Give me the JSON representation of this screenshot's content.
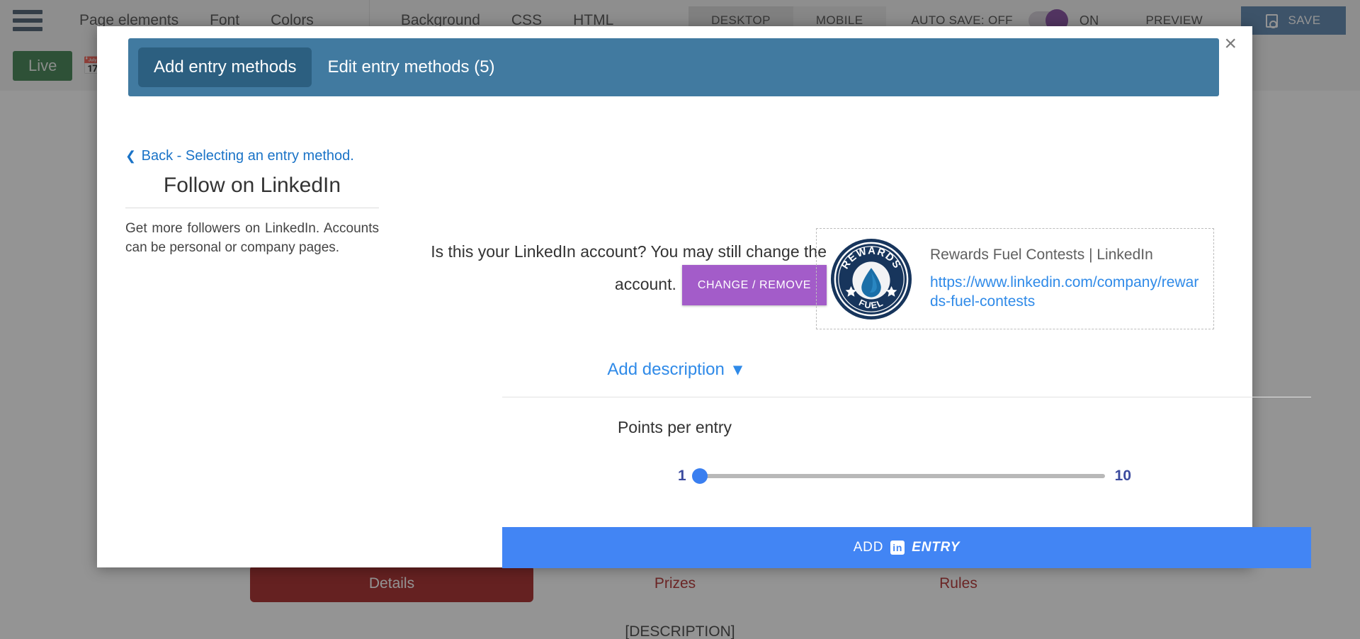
{
  "toolbar": {
    "menu_icon": "hamburger-icon",
    "items": [
      "Page elements",
      "Font",
      "Colors",
      "Background",
      "CSS",
      "HTML"
    ],
    "desktop_label": "DESKTOP",
    "mobile_label": "MOBILE",
    "autosave_label": "AUTO SAVE: OFF",
    "toggle_on_label": "ON",
    "preview_label": "PREVIEW",
    "save_label": "SAVE"
  },
  "secondbar": {
    "live_label": "Live",
    "calendar_icon": "calendar-icon",
    "clock_icon": "clock-icon"
  },
  "canvas": {
    "tabs": [
      {
        "label": "Details",
        "active": true
      },
      {
        "label": "Prizes",
        "active": false
      },
      {
        "label": "Rules",
        "active": false
      }
    ],
    "description_placeholder": "[DESCRIPTION]",
    "active_tab_color": "#970000",
    "inactive_tab_color": "#a40a0a"
  },
  "modal": {
    "close_icon": "close-icon",
    "tabs": [
      {
        "label": "Add entry methods",
        "active": true
      },
      {
        "label": "Edit entry methods (5)",
        "active": false
      }
    ],
    "header_bg": "#417aa0",
    "active_tab_bg": "#2c5f80",
    "back_link": "Back - Selecting an entry method.",
    "back_chevron_icon": "chevron-left-icon",
    "left": {
      "title": "Follow on LinkedIn",
      "description": "Get more followers on LinkedIn. Accounts can be personal or company pages."
    },
    "account": {
      "question": "Is this your LinkedIn account? You may still change the account.",
      "change_button": "CHANGE / REMOVE",
      "change_button_color": "#a35cc9",
      "card_title": "Rewards Fuel Contests | LinkedIn",
      "card_url": "https://www.linkedin.com/company/rewards-fuel-contests",
      "card_url_color": "#2f8ae8",
      "logo_icon": "rewards-fuel-logo-icon",
      "logo_text_top": "REWARDS",
      "logo_text_bottom": "FUEL"
    },
    "add_description": {
      "label": "Add description",
      "chevron_icon": "chevron-down-icon",
      "color": "#2f8ae8"
    },
    "points": {
      "label": "Points per entry",
      "min": "1",
      "max": "10",
      "value": 1,
      "thumb_color": "#3a7ff0"
    },
    "submit": {
      "prefix": "ADD",
      "icon": "linkedin-in-icon",
      "icon_text": "in",
      "suffix": "ENTRY",
      "color": "#4285f4"
    }
  }
}
